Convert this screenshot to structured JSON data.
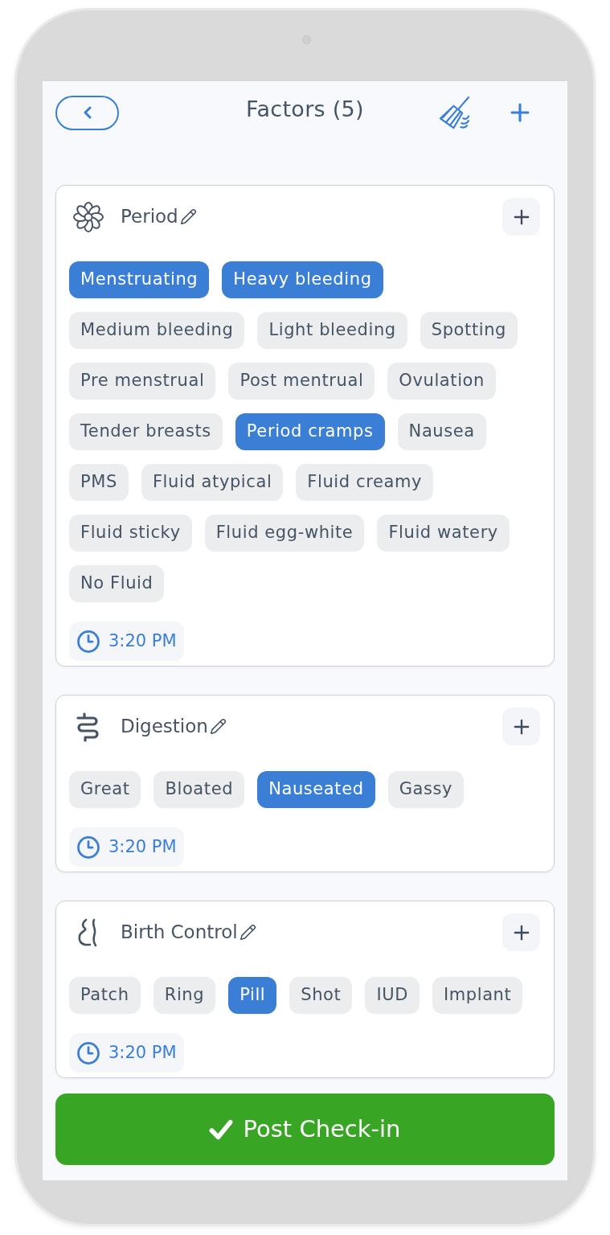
{
  "header": {
    "title": "Factors (5)"
  },
  "sections": [
    {
      "title": "Period",
      "kind": "period",
      "options": [
        {
          "label": "Menstruating",
          "selected": true
        },
        {
          "label": "Heavy bleeding",
          "selected": true
        },
        {
          "label": "Medium bleeding",
          "selected": false
        },
        {
          "label": "Light bleeding",
          "selected": false
        },
        {
          "label": "Spotting",
          "selected": false
        },
        {
          "label": "Pre menstrual",
          "selected": false
        },
        {
          "label": "Post mentrual",
          "selected": false
        },
        {
          "label": "Ovulation",
          "selected": false
        },
        {
          "label": "Tender breasts",
          "selected": false
        },
        {
          "label": "Period cramps",
          "selected": true
        },
        {
          "label": "Nausea",
          "selected": false
        },
        {
          "label": "PMS",
          "selected": false
        },
        {
          "label": "Fluid atypical",
          "selected": false
        },
        {
          "label": "Fluid creamy",
          "selected": false
        },
        {
          "label": "Fluid sticky",
          "selected": false
        },
        {
          "label": "Fluid egg-white",
          "selected": false
        },
        {
          "label": "Fluid watery",
          "selected": false
        },
        {
          "label": "No Fluid",
          "selected": false
        }
      ],
      "time": "3:20 PM"
    },
    {
      "title": "Digestion",
      "kind": "digestion",
      "options": [
        {
          "label": "Great",
          "selected": false
        },
        {
          "label": "Bloated",
          "selected": false
        },
        {
          "label": "Nauseated",
          "selected": true
        },
        {
          "label": "Gassy",
          "selected": false
        }
      ],
      "time": "3:20 PM"
    },
    {
      "title": "Birth Control",
      "kind": "contraception",
      "options": [
        {
          "label": "Patch",
          "selected": false
        },
        {
          "label": "Ring",
          "selected": false
        },
        {
          "label": "Pill",
          "selected": true
        },
        {
          "label": "Shot",
          "selected": false
        },
        {
          "label": "IUD",
          "selected": false
        },
        {
          "label": "Implant",
          "selected": false
        }
      ],
      "time": "3:20 PM"
    }
  ],
  "submit_button": {
    "label": "Post Check-in"
  }
}
